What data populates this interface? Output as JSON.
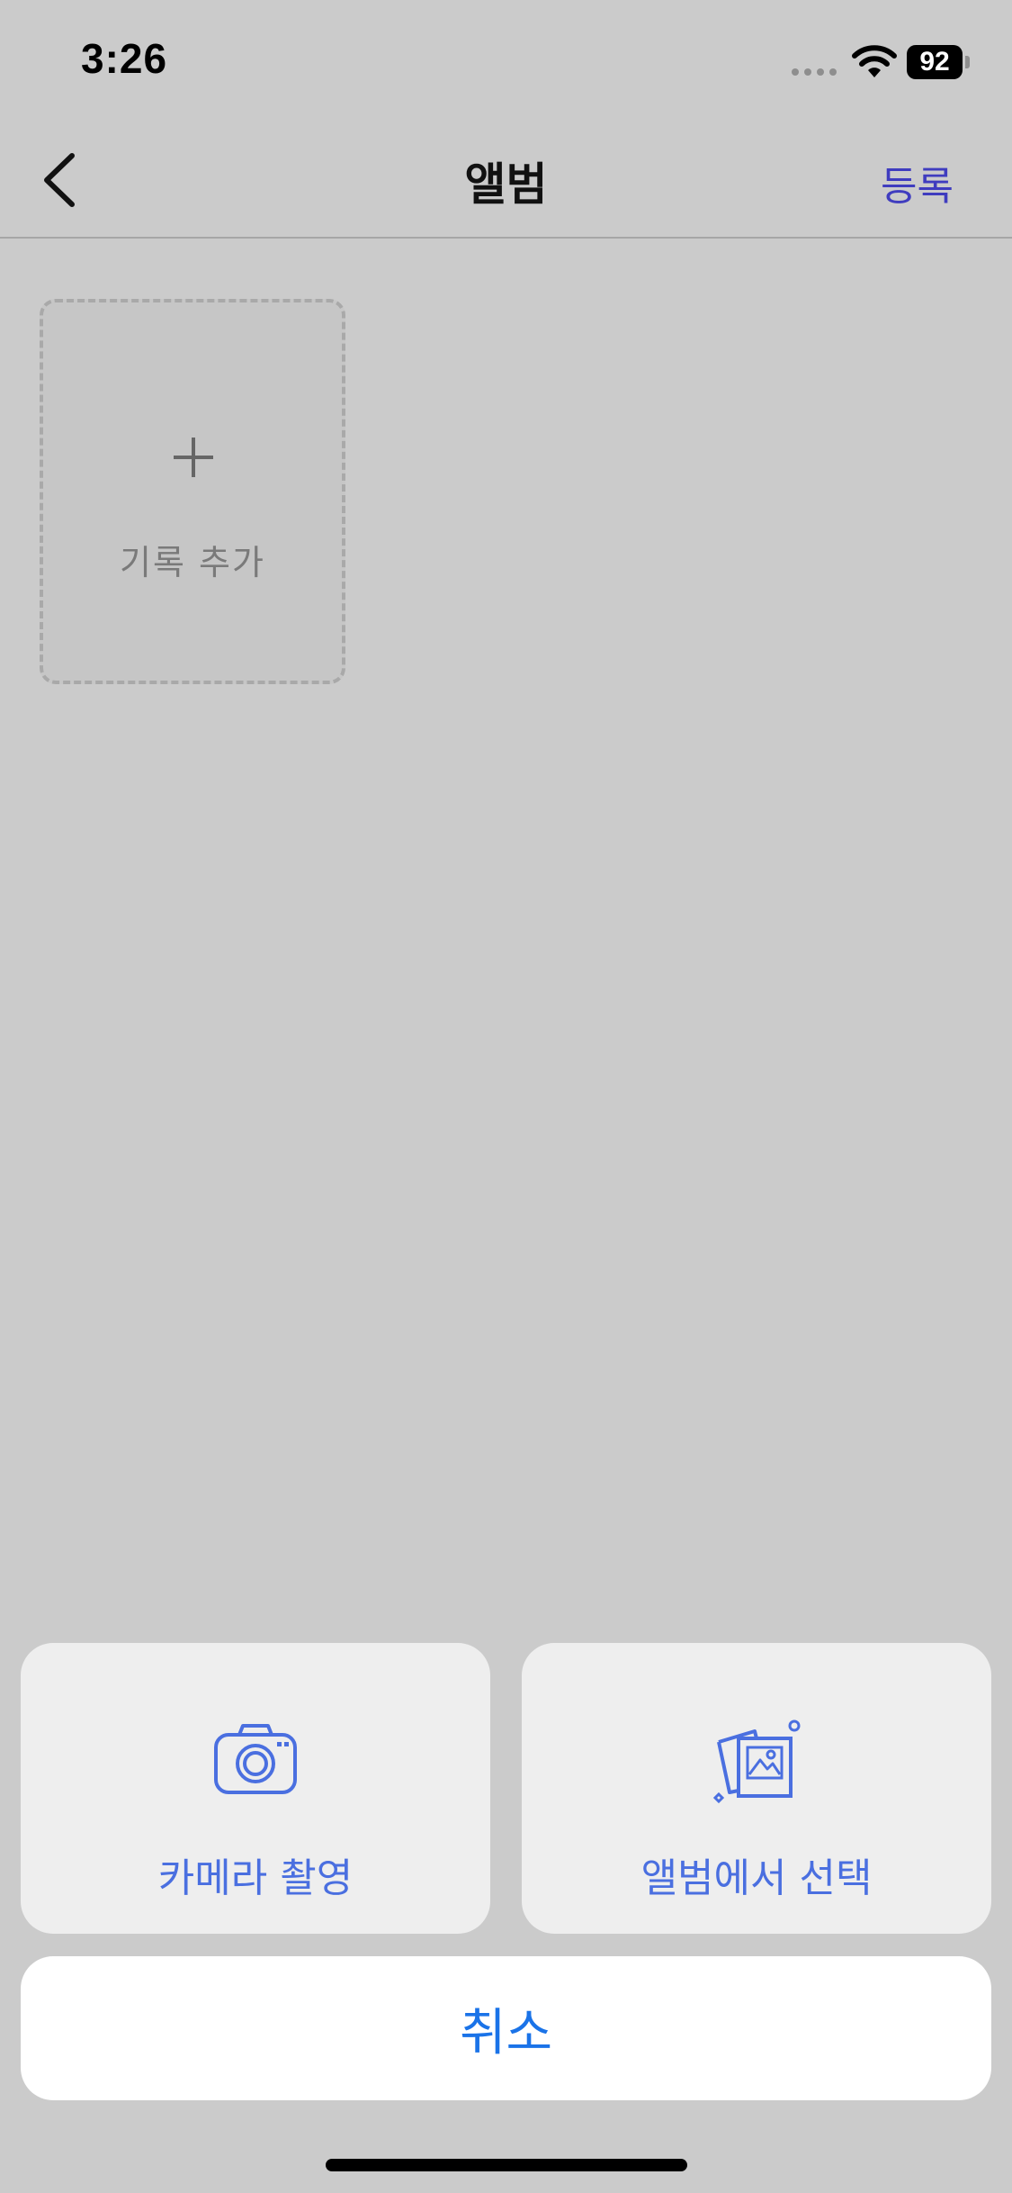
{
  "status_bar": {
    "time": "3:26",
    "battery_level": "92",
    "icons": [
      "signal-dots-icon",
      "wifi-icon",
      "battery-icon"
    ]
  },
  "nav": {
    "back_icon": "chevron-left-icon",
    "title": "앨범",
    "action_label": "등록",
    "action_color": "#3f3cbf"
  },
  "album": {
    "add_record": {
      "icon": "plus-icon",
      "label": "기록 추가"
    }
  },
  "action_sheet": {
    "options": [
      {
        "icon": "camera-icon",
        "label": "카메라 촬영"
      },
      {
        "icon": "photo-gallery-icon",
        "label": "앨범에서 선택"
      }
    ],
    "cancel_label": "취소",
    "accent_color": "#4a6fe0"
  },
  "colors": {
    "background": "#cbcbcb",
    "card_background": "#eeeeee",
    "cancel_text": "#1a73e8"
  }
}
